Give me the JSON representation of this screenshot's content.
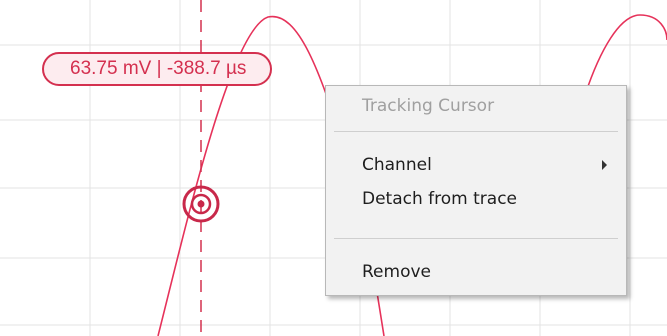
{
  "cursor_readout": {
    "text": "63.75 mV | -388.7 µs"
  },
  "context_menu": {
    "header": "Tracking Cursor",
    "items": [
      {
        "label": "Channel",
        "has_submenu": true
      },
      {
        "label": "Detach from trace",
        "has_submenu": false
      },
      {
        "label": "Remove",
        "has_submenu": false
      }
    ]
  },
  "colors": {
    "trace": "#e6325a",
    "cursor": "#d4304f",
    "grid": "#e3e3e3",
    "menu_background": "#f2f2f2"
  },
  "icons": {
    "cursor_marker": "target-marker-icon",
    "submenu": "chevron-right-icon"
  }
}
